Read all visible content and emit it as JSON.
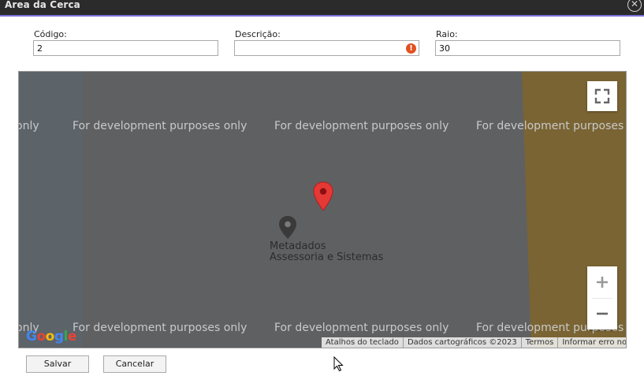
{
  "window": {
    "title": "Área da Cerca",
    "close_glyph": "✕"
  },
  "form": {
    "codigo": {
      "label": "Código:",
      "value": "2"
    },
    "descricao": {
      "label": "Descrição:",
      "value": "",
      "warning_glyph": "!"
    },
    "raio": {
      "label": "Raio:",
      "value": "30"
    }
  },
  "map": {
    "watermark": "For development purposes only",
    "watermark_partial_left": "only",
    "watermark_partial_right": "For development purposes o",
    "place_name_line1": "Metadados",
    "place_name_line2": "Assessoria e Sistemas",
    "attribution": [
      "Atalhos do teclado",
      "Dados cartográficos ©2023",
      "Termos",
      "Informar erro no mapa"
    ],
    "logo_letters": [
      "G",
      "o",
      "o",
      "g",
      "l",
      "e"
    ],
    "colors": {
      "map_bg": "#5f6062",
      "left_strip": "#5c6369",
      "right_area": "#7a6433",
      "marker_red": "#e53935",
      "place_marker": "#3a3a3a"
    }
  },
  "actions": {
    "save_label": "Salvar",
    "cancel_label": "Cancelar"
  }
}
